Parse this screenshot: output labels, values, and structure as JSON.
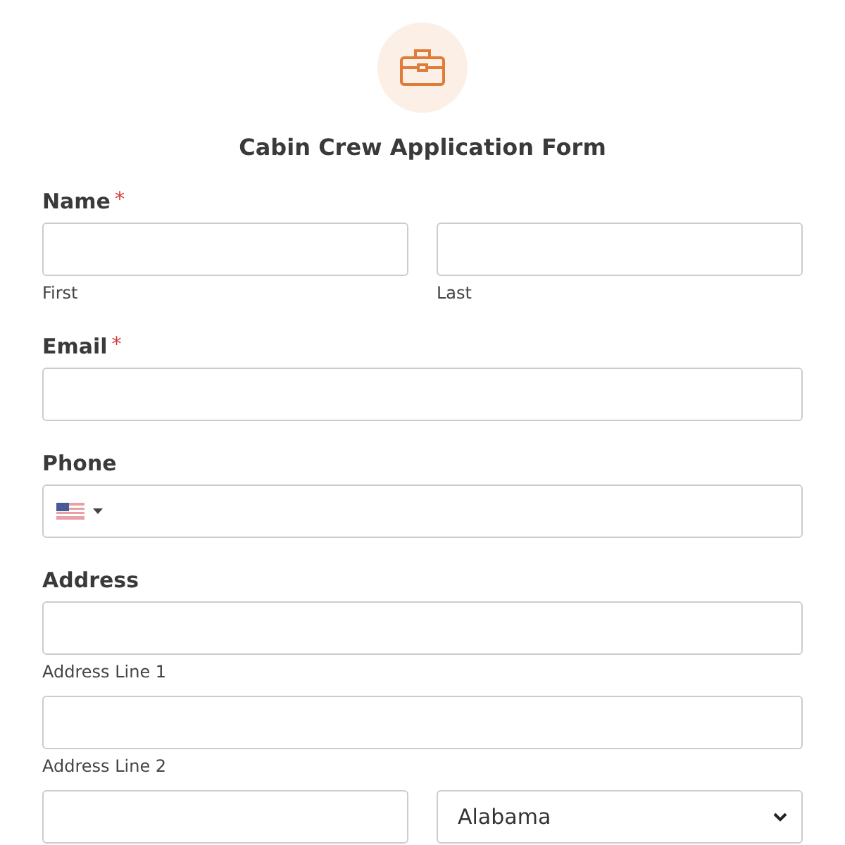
{
  "form": {
    "title": "Cabin Crew Application Form"
  },
  "fields": [
    {
      "kind": "split",
      "label": "Name",
      "required_mark": "*",
      "inputs": [
        {
          "sublabel": "First"
        },
        {
          "sublabel": "Last"
        }
      ]
    },
    {
      "kind": "text",
      "label": "Email",
      "required_mark": "*"
    },
    {
      "kind": "phone",
      "label": "Phone"
    },
    {
      "kind": "address",
      "label": "Address",
      "lines": [
        {
          "sublabel": "Address Line 1"
        },
        {
          "sublabel": "Address Line 2"
        }
      ],
      "state_value": "Alabama"
    }
  ]
}
